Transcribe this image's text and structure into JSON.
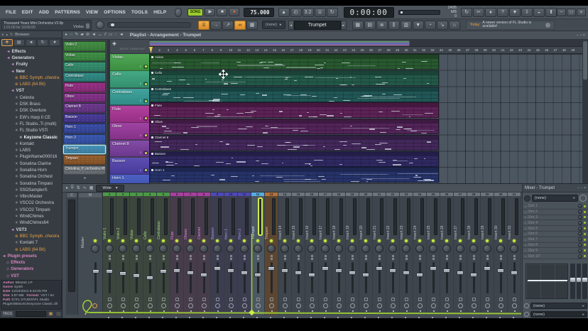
{
  "titlebar": {
    "menu": [
      "FILE",
      "EDIT",
      "ADD",
      "PATTERNS",
      "VIEW",
      "OPTIONS",
      "TOOLS",
      "HELP"
    ],
    "mode_label": "SONG",
    "tempo": "75.000",
    "time_display": "0:00:00",
    "memory": "2495 MB",
    "memory_sub": "0"
  },
  "infobar": {
    "project_title": "Thousand Years Mini Orchestra V2.flp",
    "project_length": "1:01:00 for 33:00:00",
    "hint_track": "Violas",
    "none_value": "(none)",
    "pattern_name": "Trumpet",
    "notification_day": "Today:",
    "notification_text": "A newer version of FL Studio is available!"
  },
  "browser": {
    "title": "Browser",
    "tree": [
      {
        "label": "Effects",
        "type": "cat",
        "indent": 1
      },
      {
        "label": "Generators",
        "type": "cat",
        "indent": 1
      },
      {
        "label": "Fruity",
        "type": "cat",
        "indent": 2
      },
      {
        "label": "New",
        "type": "cat",
        "indent": 2
      },
      {
        "label": "BBC Symph..chestra",
        "type": "orange",
        "indent": 3
      },
      {
        "label": "LABS (64 Bit)",
        "type": "orange",
        "indent": 3
      },
      {
        "label": "VST",
        "type": "cat",
        "indent": 2
      },
      {
        "label": "Celesta",
        "type": "plug",
        "indent": 3
      },
      {
        "label": "DSK Brass",
        "type": "plug",
        "indent": 3
      },
      {
        "label": "DSK Overture",
        "type": "plug",
        "indent": 3
      },
      {
        "label": "EW's Harp II CE",
        "type": "plug",
        "indent": 3
      },
      {
        "label": "FL Studio..Ti (multi)",
        "type": "plug",
        "indent": 3
      },
      {
        "label": "FL Studio VSTi",
        "type": "plug",
        "indent": 3
      },
      {
        "label": "Keyzone Classic",
        "type": "plugsel",
        "indent": 4
      },
      {
        "label": "Kontakt",
        "type": "plug",
        "indent": 3
      },
      {
        "label": "LABS",
        "type": "plug",
        "indent": 3
      },
      {
        "label": "PluginName000016",
        "type": "plug",
        "indent": 3
      },
      {
        "label": "Sonatina Clarine",
        "type": "plug",
        "indent": 3
      },
      {
        "label": "Sonatina Horn",
        "type": "plug",
        "indent": 3
      },
      {
        "label": "Sonatina Orchest",
        "type": "plug",
        "indent": 3
      },
      {
        "label": "Sonatina Timpani",
        "type": "plug",
        "indent": 3
      },
      {
        "label": "SSOSamplerS",
        "type": "plug",
        "indent": 3
      },
      {
        "label": "VibroMaster",
        "type": "plug",
        "indent": 3
      },
      {
        "label": "VSCO2 Orchestra",
        "type": "plug",
        "indent": 3
      },
      {
        "label": "VSCO2 Timpani",
        "type": "plug",
        "indent": 3
      },
      {
        "label": "WindChimes",
        "type": "plug",
        "indent": 3
      },
      {
        "label": "WindChimes64",
        "type": "plug",
        "indent": 3
      },
      {
        "label": "VST3",
        "type": "cat",
        "indent": 2
      },
      {
        "label": "BBC Symph..chestra",
        "type": "orange",
        "indent": 3
      },
      {
        "label": "Kontakt 7",
        "type": "plug",
        "indent": 3
      },
      {
        "label": "LABS (64 Bit)",
        "type": "orange",
        "indent": 3
      },
      {
        "label": "Plugin presets",
        "type": "phead",
        "indent": 0
      },
      {
        "label": "Effects",
        "type": "preset",
        "indent": 1
      },
      {
        "label": "Generators",
        "type": "preset",
        "indent": 1
      },
      {
        "label": "VST",
        "type": "preset",
        "indent": 1
      }
    ],
    "info_rows": [
      {
        "k": "Author",
        "v": "Bitsonic LP"
      },
      {
        "k": "Genre",
        "v": "Synth"
      },
      {
        "k": "Date",
        "v": "12/24/2021 9:42:05 PM"
      },
      {
        "k": "Size",
        "v": "3.87 MB",
        "k2": "Format:",
        "v2": "VST / 64"
      },
      {
        "k": "Path",
        "v": "D:\\FL STUDIO\\FL Studio Plugins\\Bitsonic\\Keyzone Classic.dll"
      }
    ],
    "tags_label": "TAGS"
  },
  "playlist": {
    "breadcrumb": "Playlist - Arrangement - Trumpet",
    "add_label": "+",
    "corner_tabs": "NOTE CHAN PAT",
    "patterns": [
      {
        "name": "Violin 2",
        "color": "#4ba04b"
      },
      {
        "name": "Violas",
        "color": "#47a34f"
      },
      {
        "name": "Cello",
        "color": "#3ba37e"
      },
      {
        "name": "Contrabass",
        "color": "#379e97"
      },
      {
        "name": "Flute",
        "color": "#ab3596"
      },
      {
        "name": "Oboe",
        "color": "#96389b"
      },
      {
        "name": "Clarinet B",
        "color": "#7a3fa0"
      },
      {
        "name": "Basson",
        "color": "#5242ad"
      },
      {
        "name": "Horn 1",
        "color": "#4156bd"
      },
      {
        "name": "Horn 2",
        "color": "#3f62c6"
      },
      {
        "name": "Trumpet",
        "color": "#4da3cf",
        "selected": true
      },
      {
        "name": "Timpani",
        "color": "#a96a33"
      },
      {
        "name": "Christina_P..orchestra #8",
        "color": "#7e858c"
      }
    ],
    "tracks": [
      {
        "name": "Violas",
        "color": "#45a24b"
      },
      {
        "name": "Cello",
        "color": "#3aa37d"
      },
      {
        "name": "Contrabass",
        "color": "#369e98"
      },
      {
        "name": "Flute",
        "color": "#ac3597"
      },
      {
        "name": "Oboe",
        "color": "#98389c"
      },
      {
        "name": "Clarinet 8",
        "color": "#7b40a1"
      },
      {
        "name": "Basson",
        "color": "#5243ae"
      },
      {
        "name": "Horn 1",
        "color": "#4157be"
      }
    ],
    "bars_total": 49,
    "clip_end_bar": 34
  },
  "mixer": {
    "layout_label": "Wide",
    "current_label": "C",
    "master_label": "M",
    "master_name": "Master",
    "strips": [
      {
        "num": "1",
        "name": "Violin 1",
        "group": "green"
      },
      {
        "num": "2",
        "name": "Violin 2",
        "group": "green"
      },
      {
        "num": "3",
        "name": "Violas",
        "group": "green"
      },
      {
        "num": "4",
        "name": "Cello",
        "group": "green"
      },
      {
        "num": "5",
        "name": "Contrabass",
        "group": "green"
      },
      {
        "num": "6",
        "name": "Flute",
        "group": "mag"
      },
      {
        "num": "7",
        "name": "Oboes",
        "group": "mag"
      },
      {
        "num": "8",
        "name": "Clarinet",
        "group": "mag"
      },
      {
        "num": "9",
        "name": "Basson",
        "group": "ind"
      },
      {
        "num": "10",
        "name": "Horn 1",
        "group": "ind"
      },
      {
        "num": "11",
        "name": "Horn 2",
        "group": "ind"
      },
      {
        "num": "12",
        "name": "Trumpet",
        "group": "blue",
        "selected": true
      },
      {
        "num": "13",
        "name": "Timpani",
        "group": "org"
      },
      {
        "num": "14",
        "name": "Insert 14",
        "group": "gray"
      },
      {
        "num": "15",
        "name": "Insert 15",
        "group": "gray"
      },
      {
        "num": "16",
        "name": "Insert 16",
        "group": "gray"
      },
      {
        "num": "17",
        "name": "Insert 17",
        "group": "gray"
      },
      {
        "num": "18",
        "name": "Insert 18",
        "group": "gray"
      },
      {
        "num": "19",
        "name": "Insert 19",
        "group": "gray"
      },
      {
        "num": "20",
        "name": "Insert 20",
        "group": "gray"
      },
      {
        "num": "21",
        "name": "Insert 21",
        "group": "gray"
      },
      {
        "num": "22",
        "name": "Insert 22",
        "group": "gray"
      },
      {
        "num": "23",
        "name": "Insert 23",
        "group": "gray"
      },
      {
        "num": "24",
        "name": "Insert 24",
        "group": "gray"
      },
      {
        "num": "25",
        "name": "Insert 25",
        "group": "gray"
      },
      {
        "num": "26",
        "name": "Insert 26",
        "group": "gray"
      },
      {
        "num": "27",
        "name": "Insert 27",
        "group": "gray"
      },
      {
        "num": "28",
        "name": "Insert 28",
        "group": "gray"
      },
      {
        "num": "29",
        "name": "Insert 29",
        "group": "gray"
      },
      {
        "num": "30",
        "name": "Insert 30",
        "group": "gray"
      },
      {
        "num": "31",
        "name": "Insert 31",
        "group": "gray"
      }
    ],
    "fx": {
      "title": "Mixer - Trumpet",
      "none_label": "(none)",
      "slots": [
        "Slot 1",
        "Slot 2",
        "Slot 3",
        "Slot 4",
        "Slot 5",
        "Slot 6",
        "Slot 7",
        "Slot 8",
        "Slot 9",
        "Slot 10"
      ],
      "bottom_none_1": "(none)",
      "bottom_none_2": "(none)"
    }
  }
}
